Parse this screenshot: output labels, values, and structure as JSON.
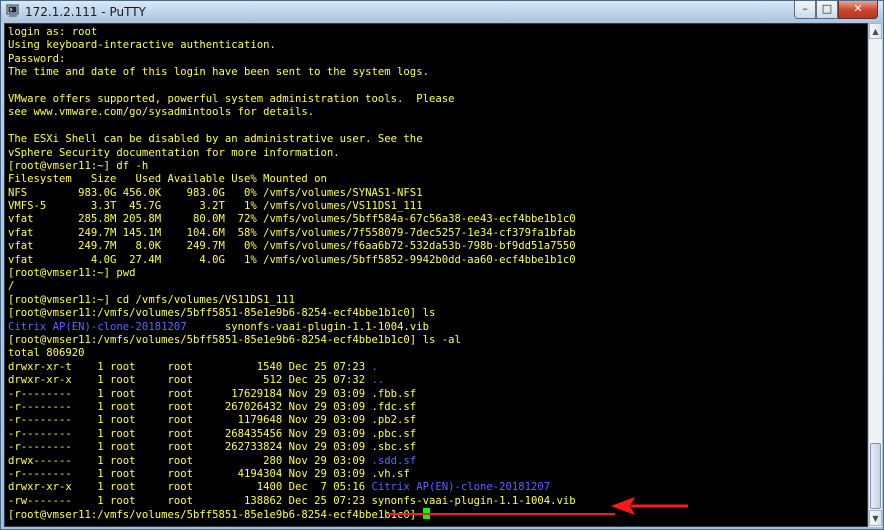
{
  "window": {
    "title": "172.1.2.111 - PuTTY",
    "controls": {
      "minimize_glyph": "–",
      "maximize_glyph": "□",
      "close_glyph": "✕"
    },
    "icon": "putty-terminal-icon"
  },
  "terminal": {
    "background": "#000000",
    "text_color": "#ffff54",
    "dir_color": "#5a66ff",
    "cursor_color": "#00ff00",
    "lines": [
      {
        "text": "login as: root"
      },
      {
        "text": "Using keyboard-interactive authentication."
      },
      {
        "text": "Password:"
      },
      {
        "text": "The time and date of this login have been sent to the system logs."
      },
      {
        "text": ""
      },
      {
        "text": "VMware offers supported, powerful system administration tools.  Please"
      },
      {
        "text": "see www.vmware.com/go/sysadmintools for details."
      },
      {
        "text": ""
      },
      {
        "text": "The ESXi Shell can be disabled by an administrative user. See the"
      },
      {
        "text": "vSphere Security documentation for more information."
      },
      {
        "text": "[root@vmser11:~] df -h"
      },
      {
        "text": "Filesystem   Size   Used Available Use% Mounted on"
      },
      {
        "text": "NFS        983.0G 456.0K    983.0G   0% /vmfs/volumes/SYNAS1-NFS1"
      },
      {
        "text": "VMFS-5       3.3T  45.7G      3.2T   1% /vmfs/volumes/VS11DS1_111"
      },
      {
        "text": "vfat       285.8M 205.8M     80.0M  72% /vmfs/volumes/5bff584a-67c56a38-ee43-ecf4bbe1b1c0"
      },
      {
        "text": "vfat       249.7M 145.1M    104.6M  58% /vmfs/volumes/7f558079-7dec5257-1e34-cf379fa1bfab"
      },
      {
        "text": "vfat       249.7M   8.0K    249.7M   0% /vmfs/volumes/f6aa6b72-532da53b-798b-bf9dd51a7550"
      },
      {
        "text": "vfat         4.0G  27.4M      4.0G   1% /vmfs/volumes/5bff5852-9942b0dd-aa60-ecf4bbe1b1c0"
      },
      {
        "text": "[root@vmser11:~] pwd"
      },
      {
        "text": "/"
      },
      {
        "text": "[root@vmser11:~] cd /vmfs/volumes/VS11DS1_111"
      },
      {
        "text": "[root@vmser11:/vmfs/volumes/5bff5851-85e1e9b6-8254-ecf4bbe1b1c0] ls"
      },
      {
        "pre": "",
        "blue": "Citrix AP(EN)-clone-20181207",
        "post": "      synonfs-vaai-plugin-1.1-1004.vib"
      },
      {
        "text": "[root@vmser11:/vmfs/volumes/5bff5851-85e1e9b6-8254-ecf4bbe1b1c0] ls -al"
      },
      {
        "text": "total 806920"
      },
      {
        "pre": "drwxr-xr-t    1 root     root          1540 Dec 25 07:23 ",
        "blue": "."
      },
      {
        "pre": "drwxr-xr-x    1 root     root           512 Dec 25 07:32 ",
        "blue": ".."
      },
      {
        "pre": "-r--------    1 root     root      17629184 Nov 29 03:09 .fbb.sf"
      },
      {
        "pre": "-r--------    1 root     root     267026432 Nov 29 03:09 .fdc.sf"
      },
      {
        "pre": "-r--------    1 root     root       1179648 Nov 29 03:09 .pb2.sf"
      },
      {
        "pre": "-r--------    1 root     root     268435456 Nov 29 03:09 .pbc.sf"
      },
      {
        "pre": "-r--------    1 root     root     262733824 Nov 29 03:09 .sbc.sf"
      },
      {
        "pre": "drwx------    1 root     root           280 Nov 29 03:09 ",
        "blue": ".sdd.sf"
      },
      {
        "pre": "-r--------    1 root     root       4194304 Nov 29 03:09 .vh.sf"
      },
      {
        "pre": "drwxr-xr-x    1 root     root          1400 Dec  7 05:16 ",
        "blue": "Citrix AP(EN)-clone-20181207"
      },
      {
        "pre": "-rw-------    1 root     root        138862 Dec 25 07:23 synonfs-vaai-plugin-1.1-1004.vib"
      },
      {
        "text": "[root@vmser11:/vmfs/volumes/5bff5851-85e1e9b6-8254-ecf4bbe1b1c0] ",
        "cursor": true
      }
    ]
  },
  "annotation": {
    "color": "#ff1a1a",
    "highlighted_file": "synonfs-vaai-plugin-1.1-1004.vib"
  },
  "scrollbar": {
    "up_glyph": "▲",
    "down_glyph": "▼"
  }
}
